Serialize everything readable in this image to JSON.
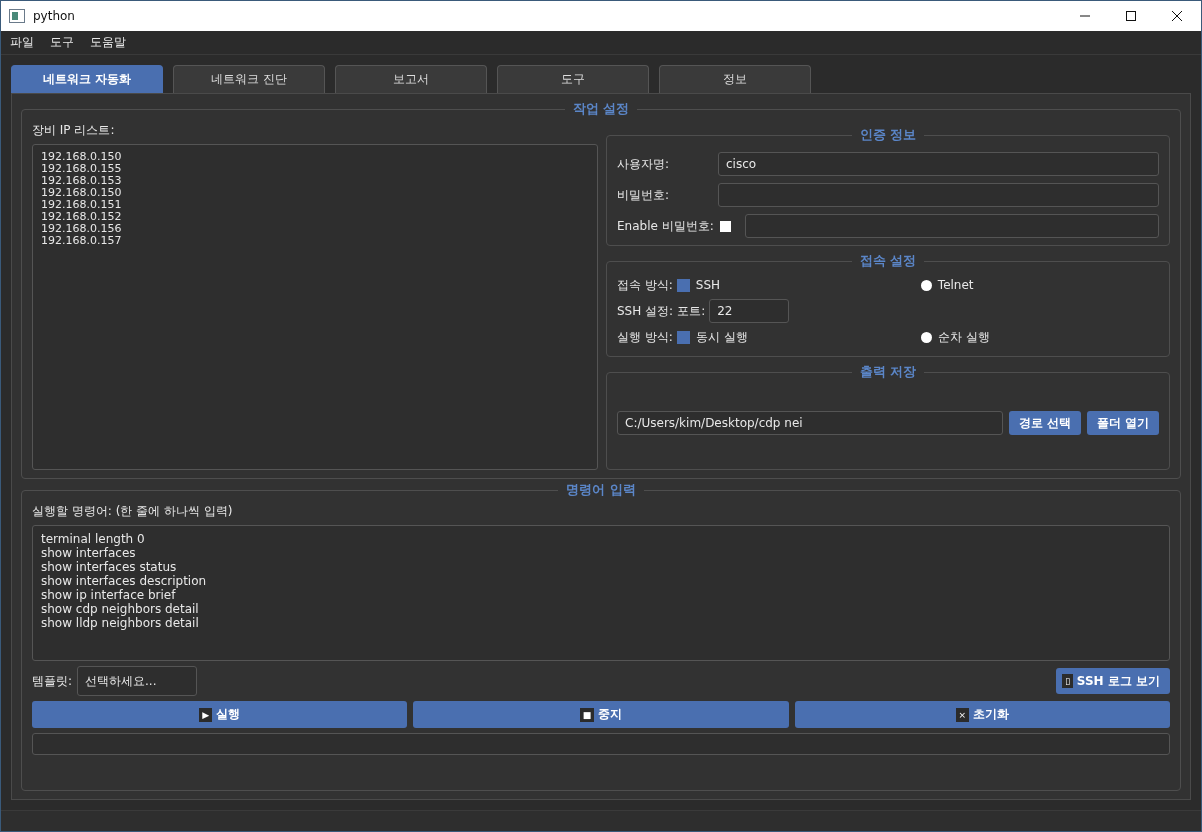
{
  "window": {
    "title": "python"
  },
  "menu": [
    "파일",
    "도구",
    "도움말"
  ],
  "tabs": [
    {
      "label": "네트워크 자동화",
      "selected": true
    },
    {
      "label": "네트워크 진단",
      "selected": false
    },
    {
      "label": "보고서",
      "selected": false
    },
    {
      "label": "도구",
      "selected": false
    },
    {
      "label": "정보",
      "selected": false
    }
  ],
  "task_settings": {
    "title": "작업 설정",
    "ip_list_label": "장비 IP 리스트:",
    "ip_list": [
      "192.168.0.150",
      "192.168.0.155",
      "192.168.0.153",
      "192.168.0.150",
      "192.168.0.151",
      "192.168.0.152",
      "192.168.0.156",
      "192.168.0.157"
    ]
  },
  "auth": {
    "title": "인증 정보",
    "username_label": "사용자명:",
    "username": "cisco",
    "password_label": "비밀번호:",
    "enable_label": "Enable 비밀번호:",
    "enable_checked": false
  },
  "connection": {
    "title": "접속 설정",
    "method_label": "접속 방식:",
    "methods": [
      {
        "label": "SSH",
        "selected": true
      },
      {
        "label": "Telnet",
        "selected": false
      }
    ],
    "ssh_label": "SSH 설정:",
    "port_label": "포트:",
    "port": "22",
    "exec_label": "실행 방식:",
    "exec_modes": [
      {
        "label": "동시 실행",
        "selected": true
      },
      {
        "label": "순차 실행",
        "selected": false
      }
    ]
  },
  "output": {
    "title": "출력 저장",
    "path": "C:/Users/kim/Desktop/cdp nei",
    "buttons": [
      "경로 선택",
      "폴더 열기"
    ]
  },
  "commands": {
    "title": "명령어 입력",
    "label": "실행할 명령어: (한 줄에 하나씩 입력)",
    "lines": [
      "terminal length 0",
      "show interfaces",
      "show interfaces status",
      "show interfaces description",
      "show ip interface brief",
      "show cdp neighbors detail",
      "show lldp neighbors detail"
    ],
    "template_label": "템플릿:",
    "template": "선택하세요...",
    "log_button": {
      "icon": "▯",
      "label": "SSH 로그 보기"
    }
  },
  "actions": [
    {
      "icon": "▶",
      "label": "실행"
    },
    {
      "icon": "■",
      "label": "중지"
    },
    {
      "icon": "×",
      "label": "초기화"
    }
  ]
}
